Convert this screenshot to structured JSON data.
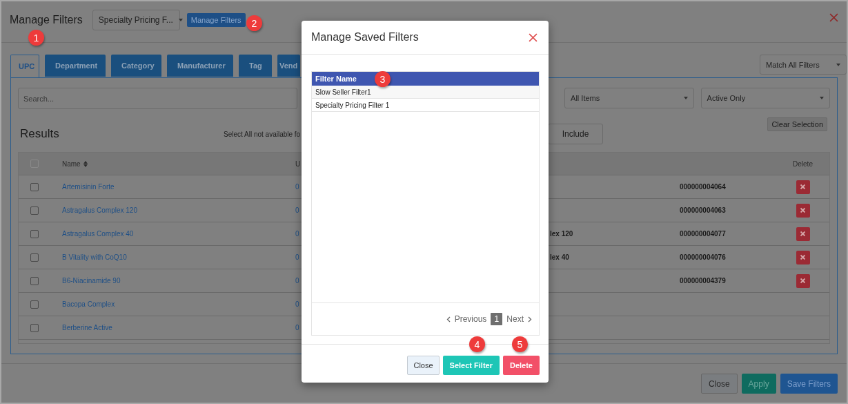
{
  "window": {
    "title": "Manage Filters",
    "saved_filter_select": "Specialty Pricing F...",
    "manage_button": "Manage Filters"
  },
  "tabs": [
    {
      "label": "UPC",
      "selected": true
    },
    {
      "label": "Department",
      "selected": false
    },
    {
      "label": "Category",
      "selected": false
    },
    {
      "label": "Manufacturer",
      "selected": false
    },
    {
      "label": "Tag",
      "selected": false
    },
    {
      "label": "Vend",
      "selected": false
    }
  ],
  "match_select": "Match All Filters",
  "search": {
    "placeholder": "Search..."
  },
  "selects": [
    "All Items",
    "Active Only"
  ],
  "results": {
    "title": "Results",
    "note": "Select All not available fo",
    "include_button": "Include",
    "clear_button": "Clear Selection"
  },
  "table": {
    "header_checked": false,
    "columns": [
      "Name",
      "U",
      "Delete"
    ],
    "rows": [
      {
        "checked": false,
        "name": "Artemisinin Forte",
        "column_3": "0",
        "column_5": "000000004064",
        "delete_button": true
      },
      {
        "checked": false,
        "name": "Astragalus Complex 120",
        "column_3": "0",
        "column_5": "000000004063",
        "delete_button": true
      },
      {
        "checked": false,
        "name": "Astragalus Complex 40",
        "column_3": "0",
        "column_4": "lex 120",
        "column_5": "000000004077",
        "delete_button": true
      },
      {
        "checked": false,
        "name": "B Vitality with CoQ10",
        "column_3": "0",
        "column_4": "lex 40",
        "column_5": "000000004076",
        "delete_button": true
      },
      {
        "checked": false,
        "name": "B6-Niacinamide 90",
        "column_3": "0",
        "column_5": "000000004379",
        "delete_button": true
      },
      {
        "checked": false,
        "name": "Bacopa Complex",
        "column_3": "0",
        "delete_button": false
      },
      {
        "checked": false,
        "name": "Berberine Active",
        "column_3": "0",
        "delete_button": false
      }
    ]
  },
  "footer_buttons": [
    {
      "label": "Close",
      "kind": "default"
    },
    {
      "label": "Apply",
      "kind": "success"
    },
    {
      "label": "Save Filters",
      "kind": "primary"
    }
  ],
  "modal": {
    "title": "Manage Saved Filters",
    "column": "Filter Name",
    "rows": [
      {
        "name": "Slow Seller Filter1",
        "selected": false
      },
      {
        "name": "Specialty Pricing Filter 1",
        "selected": false
      }
    ],
    "pagination": {
      "previous": "Previous",
      "pages": [
        {
          "label": "1",
          "selected": true
        }
      ],
      "next": "Next"
    },
    "buttons": [
      {
        "label": "Close",
        "kind": "default"
      },
      {
        "label": "Select Filter",
        "kind": "success"
      },
      {
        "label": "Delete",
        "kind": "danger"
      }
    ]
  },
  "callouts": [
    "1",
    "2",
    "3",
    "4",
    "5"
  ]
}
